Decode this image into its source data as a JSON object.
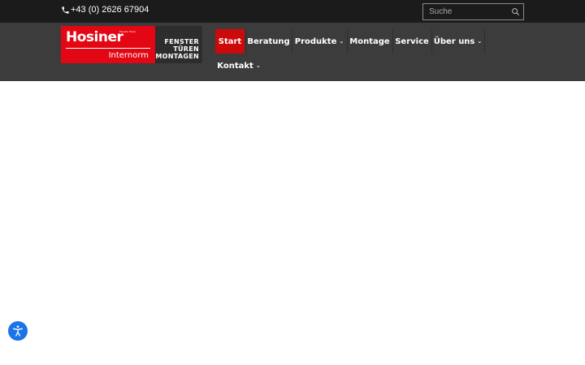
{
  "topbar": {
    "phone_icon": "phone-icon",
    "phone": "+43 (0) 2626 67904",
    "search": {
      "placeholder": "Suche",
      "icon": "search-icon"
    }
  },
  "logo": {
    "brand": "Hosiner",
    "small_text": "Fenster Türen",
    "sub": "Internorm",
    "tagline": [
      "FENSTER",
      "TÜREN",
      "MONTAGEN"
    ],
    "color": "#e30613"
  },
  "nav": {
    "items": [
      {
        "label": "Start",
        "active": true
      },
      {
        "label": "Beratung",
        "active": false
      },
      {
        "label": "Produkte",
        "dropdown": true
      },
      {
        "label": "Montage",
        "active": false
      },
      {
        "label": "Service",
        "active": false
      },
      {
        "label": "Über uns",
        "dropdown": true
      },
      {
        "label": "Kontakt",
        "dropdown": true
      }
    ],
    "active_color": "#cc0a0a"
  },
  "accessibility": {
    "icon": "accessibility-icon",
    "color": "#1a73e8"
  }
}
